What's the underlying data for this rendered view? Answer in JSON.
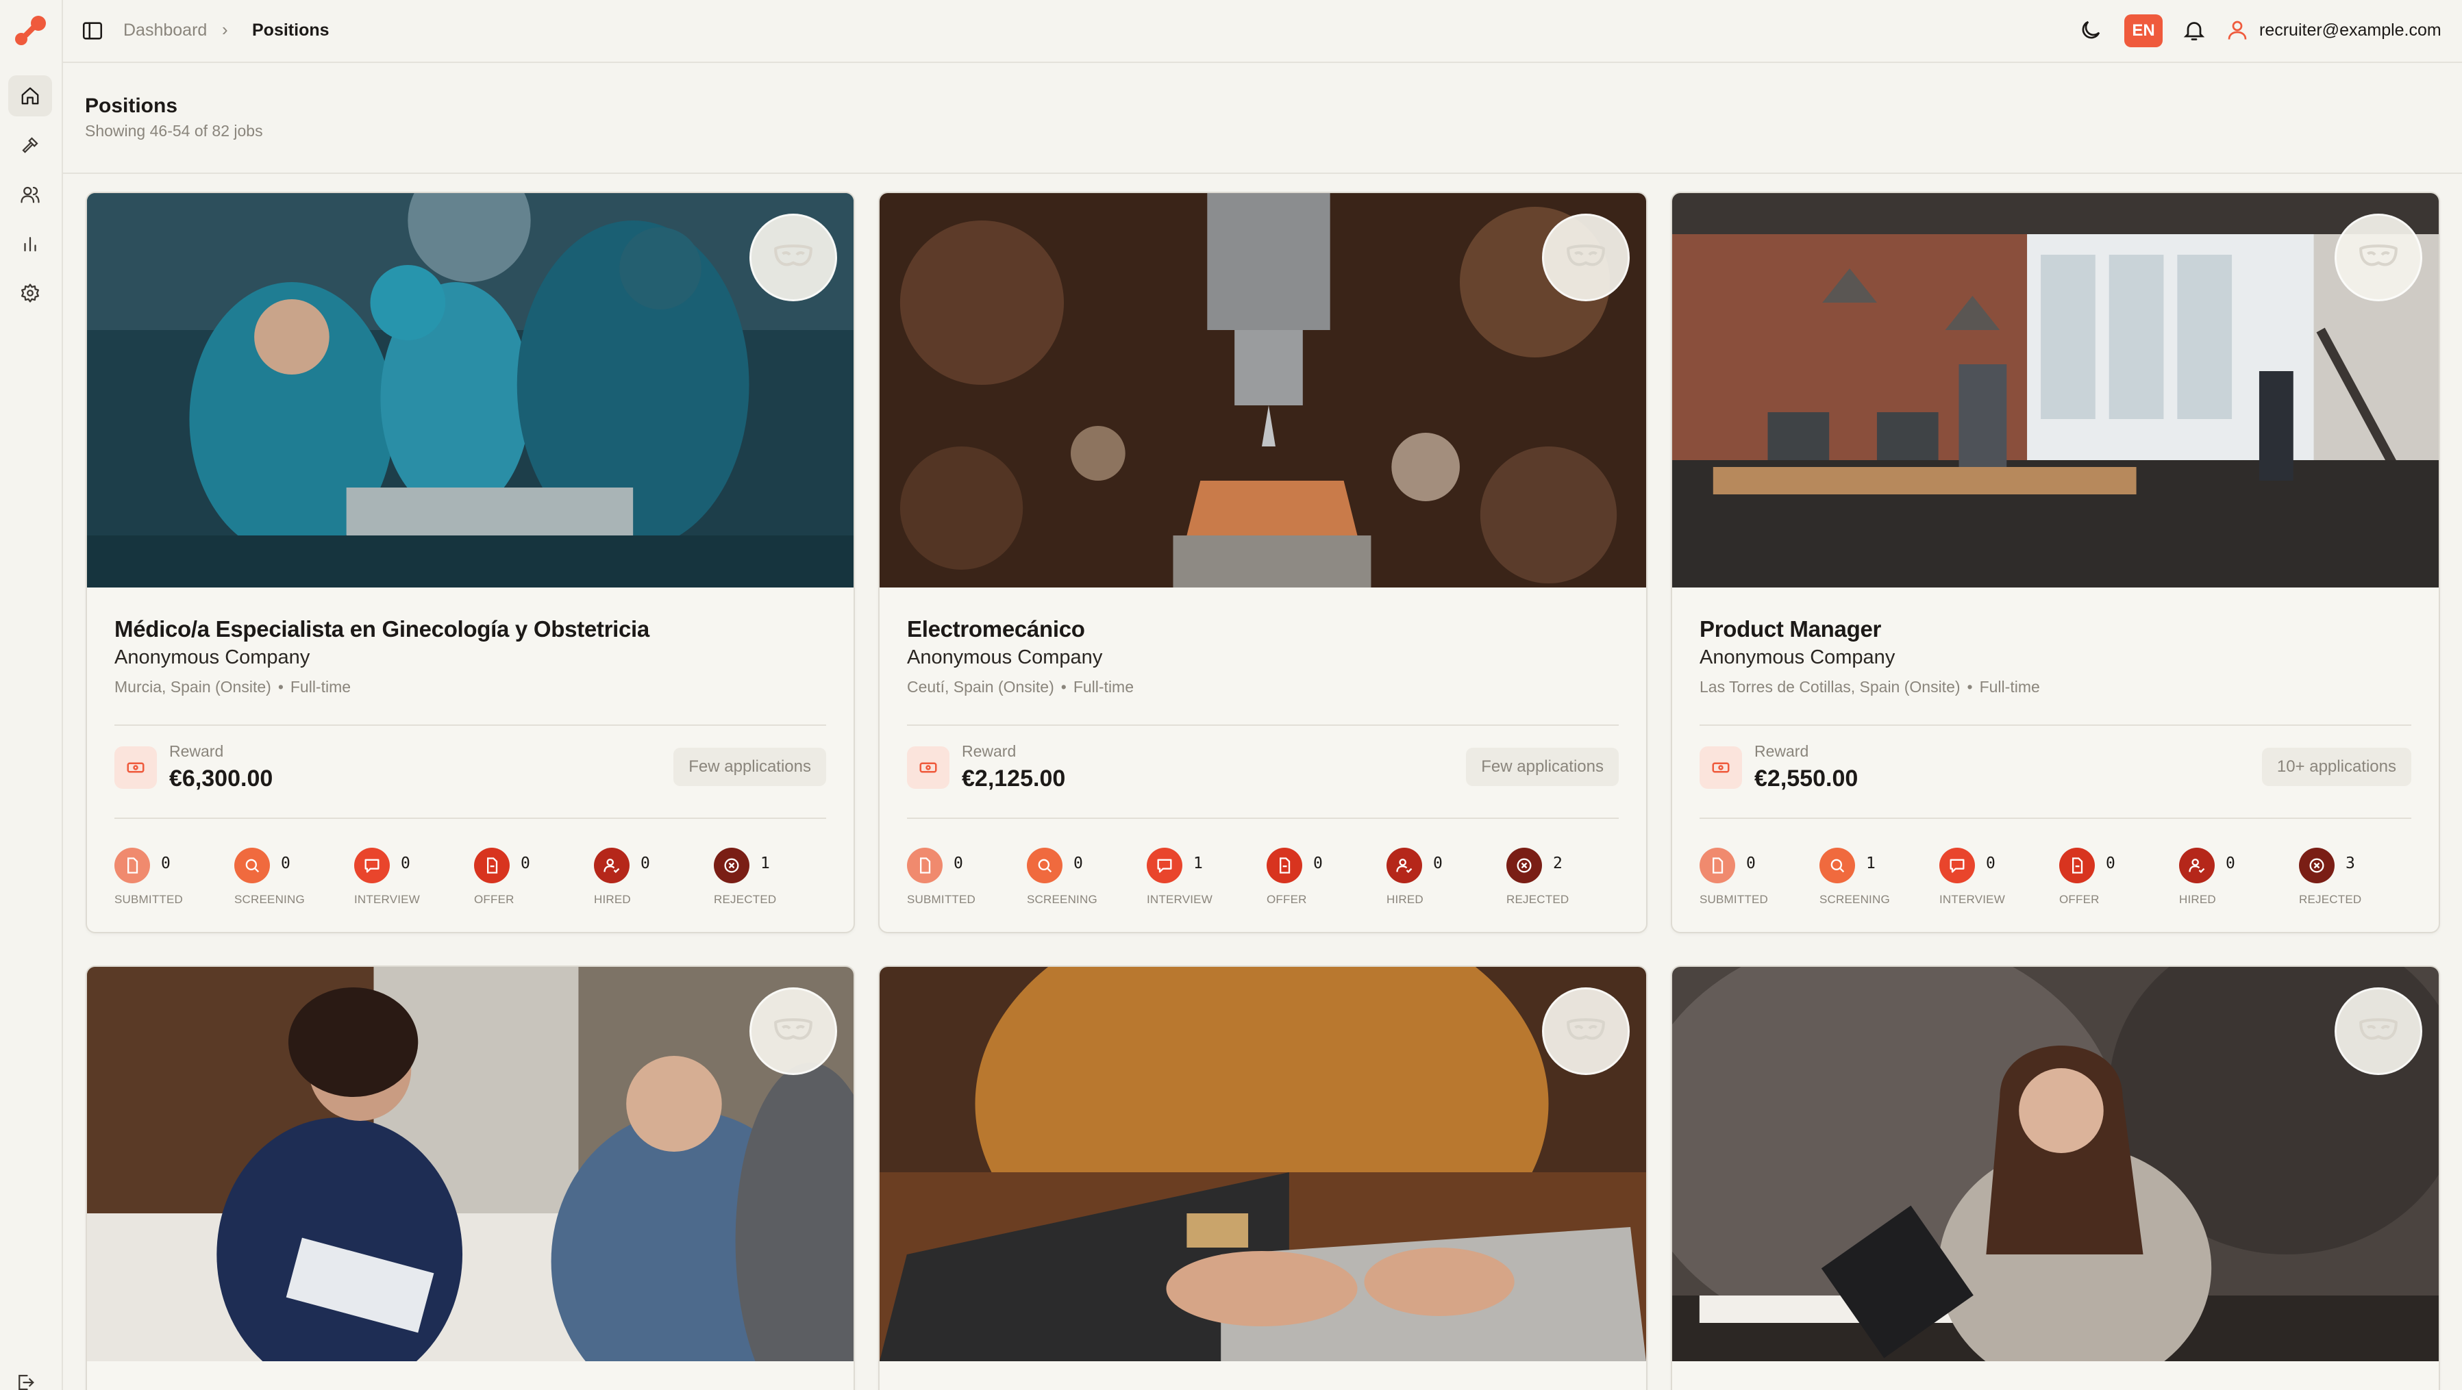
{
  "colors": {
    "accent": "#ef5a3c",
    "background": "#f5f4ef",
    "muted_text": "#8a857c"
  },
  "sidebar": {
    "logo_icon": "app-logo-icon",
    "items": [
      {
        "name": "home",
        "icon": "home-icon",
        "active": true
      },
      {
        "name": "tools",
        "icon": "hammer-icon",
        "active": false
      },
      {
        "name": "candidates",
        "icon": "users-icon",
        "active": false
      },
      {
        "name": "analytics",
        "icon": "bar-chart-icon",
        "active": false
      },
      {
        "name": "settings",
        "icon": "gear-icon",
        "active": false
      }
    ],
    "logout_icon": "logout-icon"
  },
  "header": {
    "breadcrumb_root": "Dashboard",
    "breadcrumb_sep": "›",
    "breadcrumb_current": "Positions",
    "language": "EN",
    "user_email": "recruiter@example.com"
  },
  "page": {
    "title": "Positions",
    "subtitle": "Showing 46-54 of 82 jobs"
  },
  "jobs": [
    {
      "title": "Médico/a Especialista en Ginecología y Obstetricia",
      "company": "Anonymous Company",
      "location": "Murcia, Spain (Onsite)",
      "type": "Full-time",
      "reward_label": "Reward",
      "reward": "€6,300.00",
      "applications": "Few applications",
      "stages": [
        {
          "label": "SUBMITTED",
          "count": "0"
        },
        {
          "label": "SCREENING",
          "count": "0"
        },
        {
          "label": "INTERVIEW",
          "count": "0"
        },
        {
          "label": "OFFER",
          "count": "0"
        },
        {
          "label": "HIRED",
          "count": "0"
        },
        {
          "label": "REJECTED",
          "count": "1"
        }
      ]
    },
    {
      "title": "Electromecánico",
      "company": "Anonymous Company",
      "location": "Ceutí, Spain (Onsite)",
      "type": "Full-time",
      "reward_label": "Reward",
      "reward": "€2,125.00",
      "applications": "Few applications",
      "stages": [
        {
          "label": "SUBMITTED",
          "count": "0"
        },
        {
          "label": "SCREENING",
          "count": "0"
        },
        {
          "label": "INTERVIEW",
          "count": "1"
        },
        {
          "label": "OFFER",
          "count": "0"
        },
        {
          "label": "HIRED",
          "count": "0"
        },
        {
          "label": "REJECTED",
          "count": "2"
        }
      ]
    },
    {
      "title": "Product Manager",
      "company": "Anonymous Company",
      "location": "Las Torres de Cotillas, Spain (Onsite)",
      "type": "Full-time",
      "reward_label": "Reward",
      "reward": "€2,550.00",
      "applications": "10+ applications",
      "stages": [
        {
          "label": "SUBMITTED",
          "count": "0"
        },
        {
          "label": "SCREENING",
          "count": "1"
        },
        {
          "label": "INTERVIEW",
          "count": "0"
        },
        {
          "label": "OFFER",
          "count": "0"
        },
        {
          "label": "HIRED",
          "count": "0"
        },
        {
          "label": "REJECTED",
          "count": "3"
        }
      ]
    }
  ],
  "stage_colors": {
    "submitted": "#f08a6e",
    "screening": "#f06a3e",
    "interview": "#e9452c",
    "offer": "#d8341f",
    "hired": "#b5271a",
    "rejected": "#7a1e15"
  }
}
